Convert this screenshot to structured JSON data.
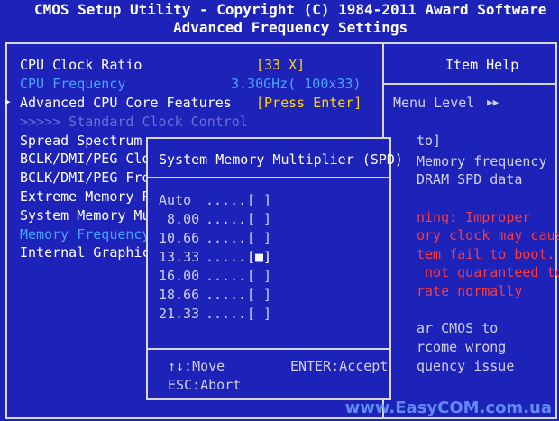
{
  "header": {
    "line1": "CMOS Setup Utility - Copyright (C) 1984-2011 Award Software",
    "line2": "Advanced Frequency Settings"
  },
  "menu": {
    "cpu_clock_ratio_label": "CPU Clock Ratio",
    "cpu_clock_ratio_value": "[33 X]",
    "cpu_frequency_label": "CPU Frequency",
    "cpu_frequency_value": "3.30GHz( 100x33)",
    "advanced_cpu_label": "Advanced CPU Core Features",
    "advanced_cpu_value": "[Press Enter]",
    "standard_clock_label": ">>>>> Standard Clock Control",
    "spread_spectrum_label": "Spread Spectrum",
    "bclk_1_label": "BCLK/DMI/PEG Cloc",
    "bclk_2_label": "BCLK/DMI/PEG Freq",
    "extreme_memory_label": "Extreme Memory Pr",
    "system_memory_label": "System Memory Mul",
    "memory_frequency_label": "Memory Frequency(",
    "internal_graphics_label": "Internal Graphics",
    "submenu_arrow": "▶"
  },
  "help": {
    "title": "Item Help",
    "menu_level": "Menu Level",
    "menu_level_arrows": "▶▶",
    "lines": [
      "to]",
      "Memory frequency",
      "DRAM SPD data",
      "ning: Improper",
      "ory clock may cause",
      "tem fail to boot.",
      " not guaranteed to",
      "rate normally",
      "ar CMOS to",
      "rcome wrong",
      "quency issue"
    ]
  },
  "popup": {
    "title": "System Memory Multiplier (SPD)",
    "options": [
      {
        "label": "Auto ",
        "dots": ".....",
        "box": "[ ]"
      },
      {
        "label": " 8.00",
        "dots": ".....",
        "box": "[ ]"
      },
      {
        "label": "10.66",
        "dots": ".....",
        "box": "[ ]"
      },
      {
        "label": "13.33",
        "dots": ".....",
        "box": "[■]"
      },
      {
        "label": "16.00",
        "dots": ".....",
        "box": "[ ]"
      },
      {
        "label": "18.66",
        "dots": ".....",
        "box": "[ ]"
      },
      {
        "label": "21.33",
        "dots": ".....",
        "box": "[ ]"
      }
    ],
    "selected_index": 3,
    "move_hint": "↑↓:Move",
    "enter_hint": "ENTER:Accept",
    "abort_hint": "ESC:Abort"
  },
  "watermark": "www.EasyCOM.com.ua",
  "colors": {
    "background": "#1d22b8",
    "value": "#ffd400",
    "highlight": "#4aa3ff",
    "warning": "#ff3a3a",
    "disabled": "#6a6fd0"
  }
}
